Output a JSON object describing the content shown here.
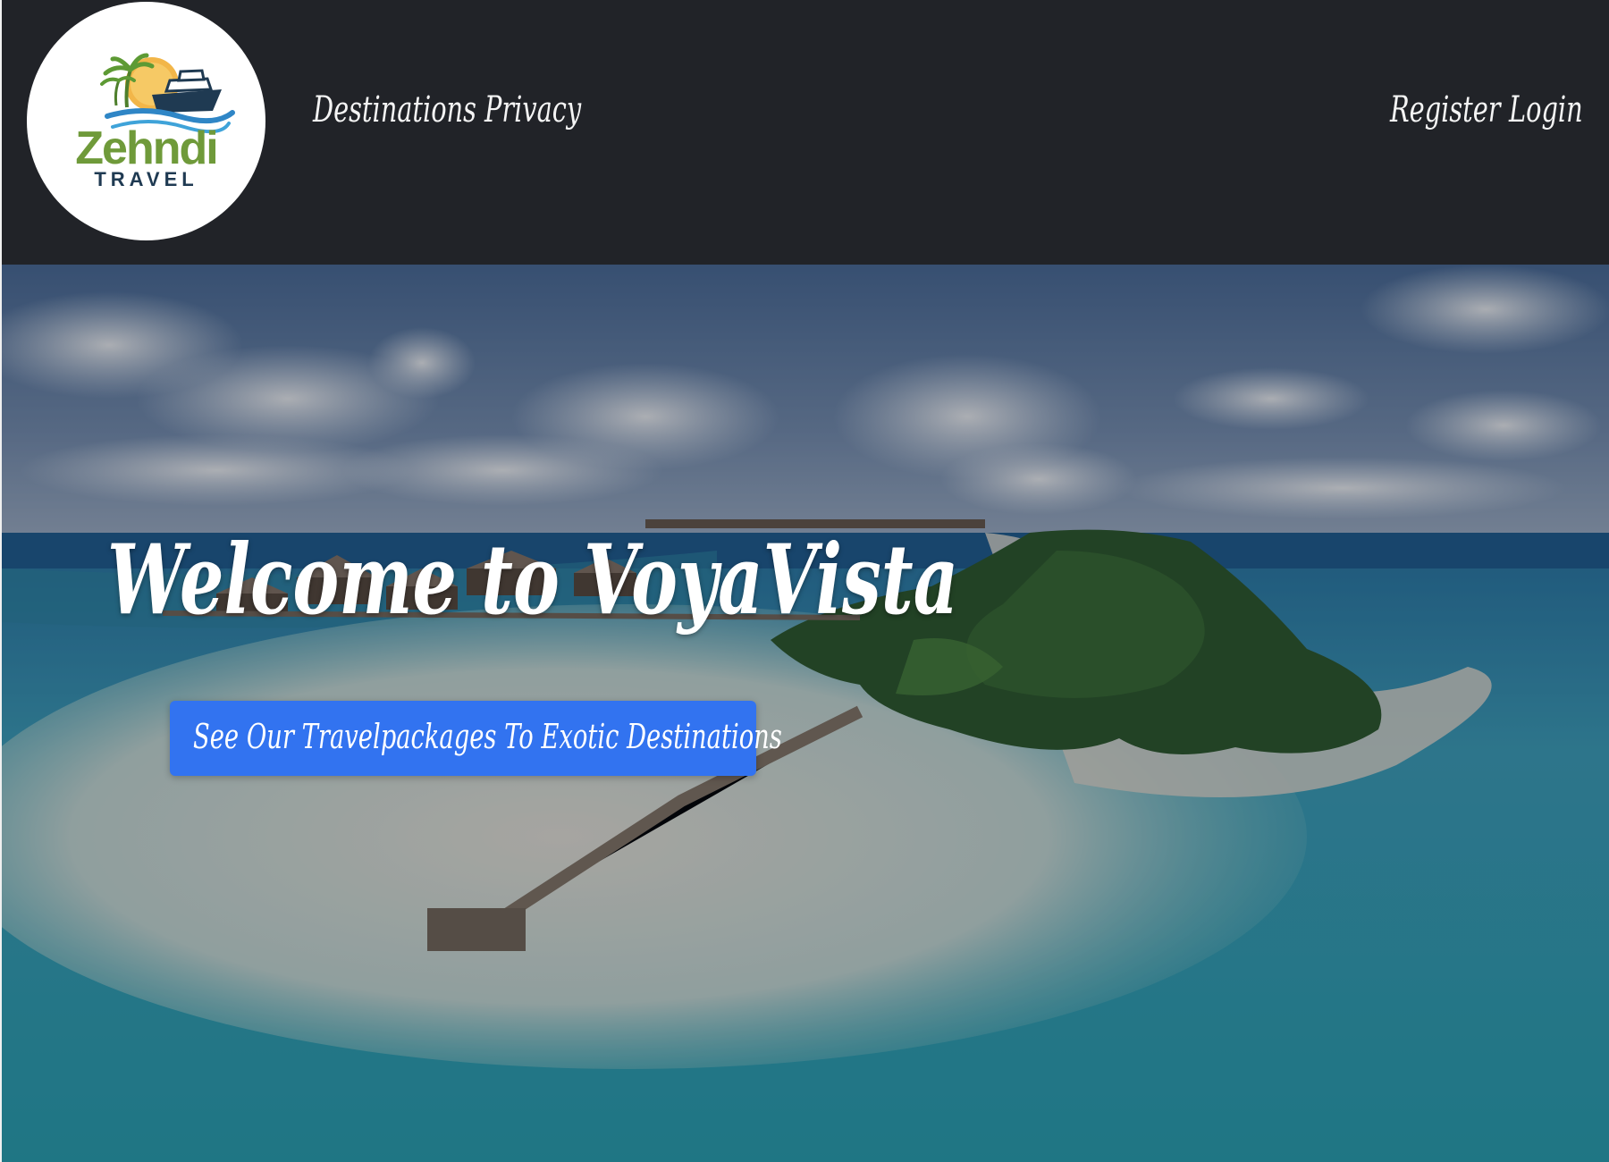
{
  "navbar": {
    "logo": {
      "brand_text": "Zehndi",
      "tagline_text": "TRAVEL"
    },
    "left_links": [
      {
        "label": "Destinations"
      },
      {
        "label": "Privacy"
      }
    ],
    "right_links": [
      {
        "label": "Register"
      },
      {
        "label": "Login"
      }
    ]
  },
  "hero": {
    "title": "Welcome to VoyaVista",
    "cta_label": "See Our Travelpackages To Exotic Destinations",
    "background_image": "aerial-tropical-island-resort-photo"
  },
  "colors": {
    "navbar_bg": "#212328",
    "cta_bg": "#3273f0",
    "logo_green": "#6f9a3a",
    "logo_navy": "#1f3a52"
  }
}
